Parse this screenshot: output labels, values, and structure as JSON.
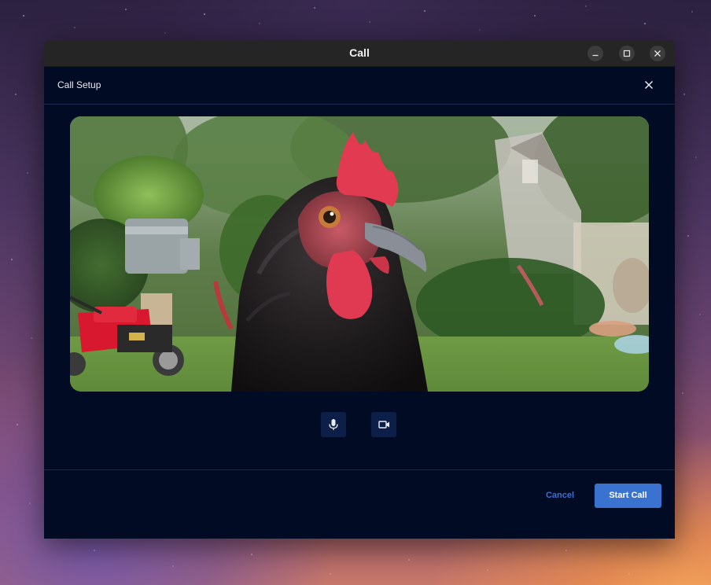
{
  "window": {
    "title": "Call"
  },
  "dialog": {
    "title": "Call Setup"
  },
  "preview": {
    "description_icon": "camera-preview-chicken"
  },
  "controls": {
    "mic_icon": "microphone-icon",
    "camera_icon": "video-camera-icon"
  },
  "footer": {
    "cancel_label": "Cancel",
    "start_label": "Start Call"
  },
  "colors": {
    "dialog_bg": "#020b24",
    "accent": "#3a73cf",
    "cancel_text": "#3f6fd1",
    "control_bg": "#0c1f48"
  }
}
